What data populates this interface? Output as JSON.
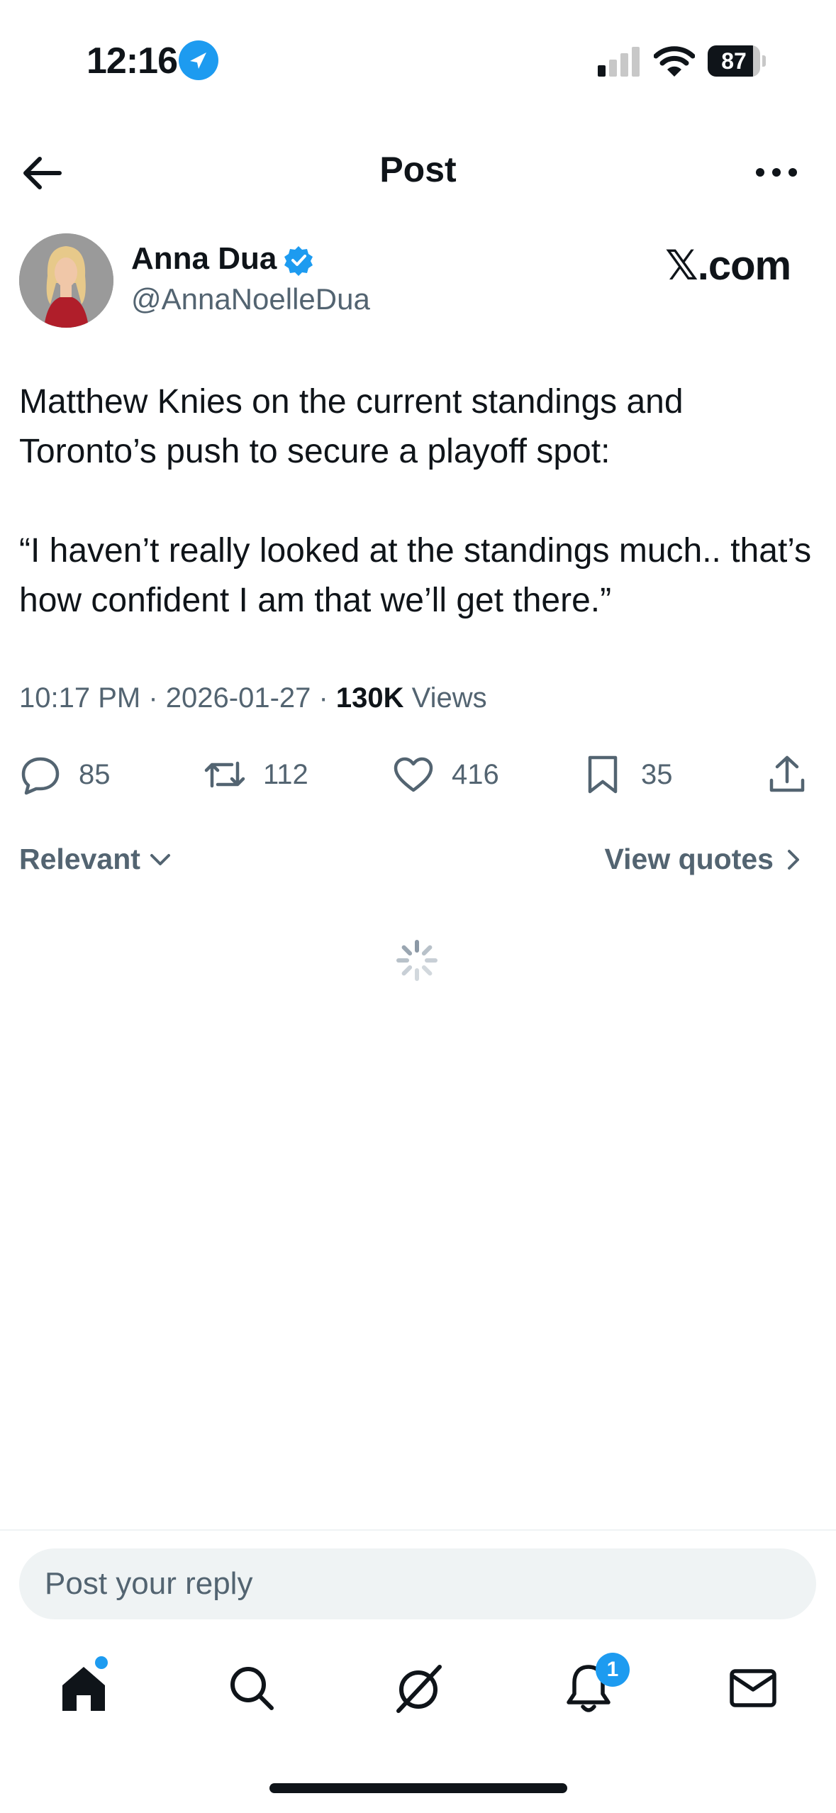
{
  "status_bar": {
    "time": "12:16",
    "battery_percent": "87",
    "battery_level": 0.87,
    "signal_bars": 1,
    "location_icon": "location-arrow-icon"
  },
  "header": {
    "title": "Post",
    "back_icon": "back-arrow-icon",
    "more_icon": "more-horizontal-icon"
  },
  "author": {
    "name": "Anna Dua",
    "handle": "@AnnaNoelleDua",
    "verified": true,
    "watermark": "𝕏.com"
  },
  "post": {
    "paragraphs": [
      "Matthew Knies on the current standings and Toronto’s push to secure a playoff spot:",
      "“I haven’t really looked at the standings much.. that’s how confident I am that we’ll get there.”"
    ],
    "time": "10:17 PM",
    "date": "2026-01-27",
    "separator": " · ",
    "views_count": "130K",
    "views_label": "Views"
  },
  "actions": {
    "replies": "85",
    "reposts": "112",
    "likes": "416",
    "bookmarks": "35"
  },
  "sort": {
    "label": "Relevant",
    "view_quotes": "View quotes"
  },
  "reply": {
    "placeholder": "Post your reply"
  },
  "tab_bar": {
    "notifications_count": "1",
    "items": [
      "home-icon",
      "search-icon",
      "grok-icon",
      "bell-icon",
      "mail-icon"
    ]
  },
  "colors": {
    "accent": "#1d9bf0",
    "text": "#0f1419",
    "secondary": "#536471"
  }
}
